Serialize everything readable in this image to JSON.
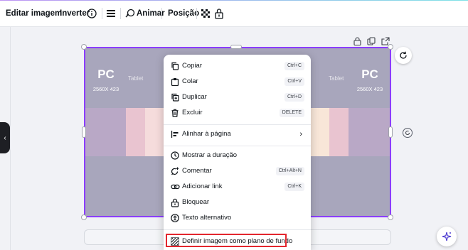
{
  "toolbar": {
    "edit_image": "Editar imagem",
    "flip": "Inverter",
    "animate": "Animar",
    "position": "Posição"
  },
  "canvas": {
    "left_label": "PC",
    "left_sub": "2560X 423",
    "right_label": "PC",
    "right_sub": "2560X 423",
    "tablet_left": "Tablet",
    "tablet_right": "Tablet"
  },
  "context_menu": {
    "items": [
      {
        "label": "Copiar",
        "shortcut": "Ctrl+C",
        "icon": "copy-icon"
      },
      {
        "label": "Colar",
        "shortcut": "Ctrl+V",
        "icon": "paste-icon"
      },
      {
        "label": "Duplicar",
        "shortcut": "Ctrl+D",
        "icon": "duplicate-icon"
      },
      {
        "label": "Excluir",
        "shortcut": "DELETE",
        "icon": "trash-icon"
      },
      {
        "label": "Alinhar à página",
        "shortcut": "",
        "icon": "align-icon"
      },
      {
        "label": "Mostrar a duração",
        "shortcut": "",
        "icon": "clock-icon"
      },
      {
        "label": "Comentar",
        "shortcut": "Ctrl+Alt+N",
        "icon": "comment-icon"
      },
      {
        "label": "Adicionar link",
        "shortcut": "Ctrl+K",
        "icon": "link-icon"
      },
      {
        "label": "Bloquear",
        "shortcut": "",
        "icon": "lock-icon"
      },
      {
        "label": "Texto alternativo",
        "shortcut": "",
        "icon": "accessibility-icon"
      },
      {
        "label": "Definir imagem como plano de fundo",
        "shortcut": "",
        "icon": "background-icon"
      }
    ]
  },
  "colors": {
    "selection": "#8b3dff",
    "highlight": "#e3262e",
    "canvas": "#a8a6bc"
  }
}
